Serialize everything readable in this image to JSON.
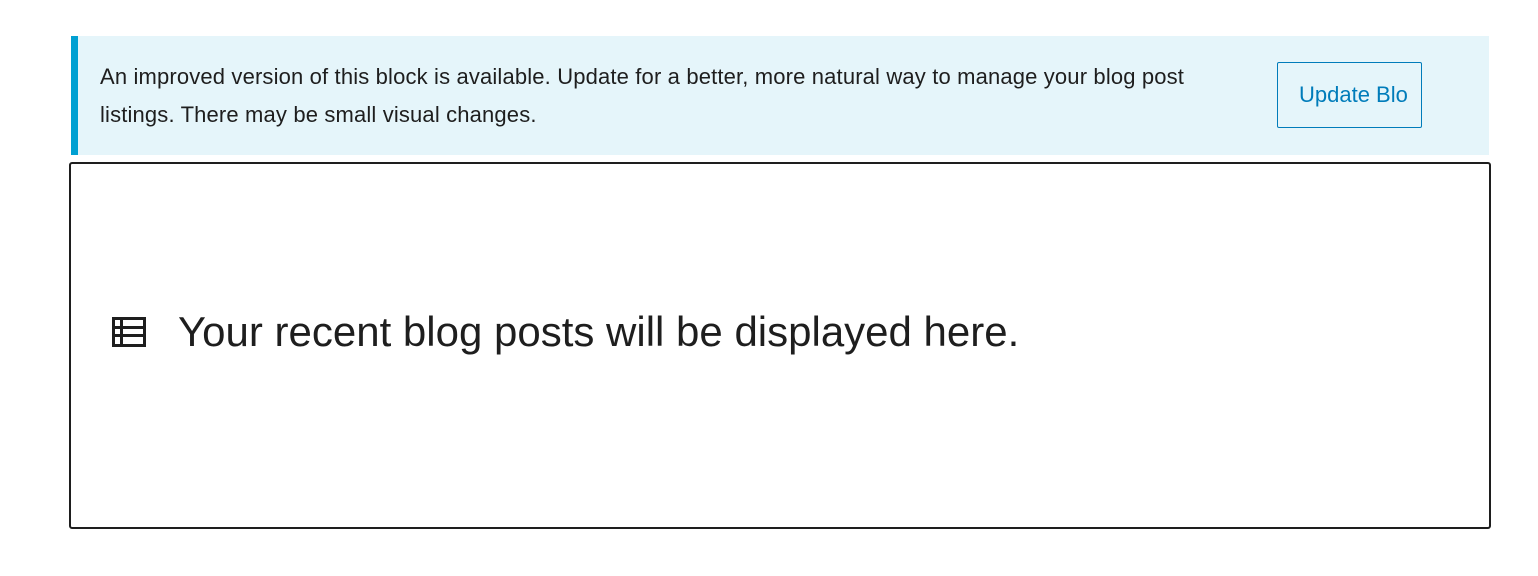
{
  "notice": {
    "message": "An improved version of this block is available. Update for a better, more natural way to manage your blog post listings. There may be small visual changes.",
    "button_label": "Update Blo",
    "accent_color": "#00a0d2",
    "background_color": "#e5f5fa"
  },
  "placeholder": {
    "icon": "post-list-icon",
    "message": "Your recent blog posts will be displayed here."
  }
}
